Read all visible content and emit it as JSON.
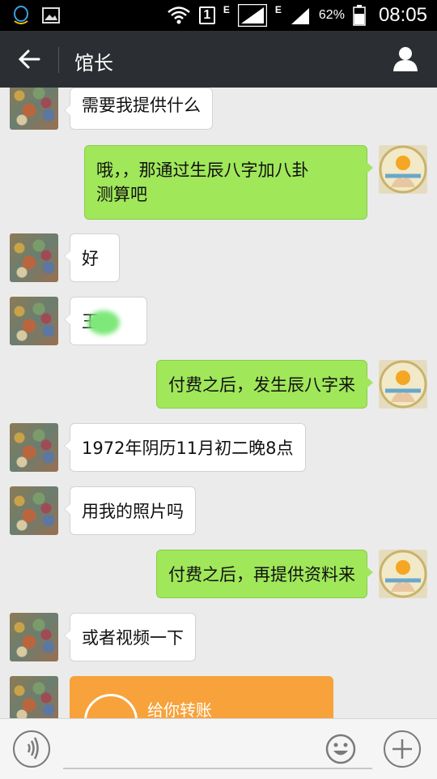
{
  "status_bar": {
    "battery": "62%",
    "time": "08:05",
    "sim": "1",
    "network_label": "E",
    "network_label2": "E",
    "icons": [
      "qq-icon",
      "image-icon",
      "wifi-icon",
      "sim-icon",
      "signal-icon",
      "battery-icon"
    ]
  },
  "header": {
    "title": "馆长",
    "back_icon": "back-arrow-icon",
    "profile_icon": "person-icon"
  },
  "messages": [
    {
      "side": "left",
      "text": "需要我提供什么"
    },
    {
      "side": "right",
      "text_line1": "哦，，那通过生辰八字加八卦",
      "text_line2": "测算吧"
    },
    {
      "side": "left",
      "text": "好"
    },
    {
      "side": "left",
      "text": "王"
    },
    {
      "side": "right",
      "text": "付费之后，发生辰八字来"
    },
    {
      "side": "left",
      "text": "1972年阴历11月初二晚8点"
    },
    {
      "side": "left",
      "text": "用我的照片吗"
    },
    {
      "side": "right",
      "text": "付费之后，再提供资料来"
    },
    {
      "side": "left",
      "text": "或者视频一下"
    },
    {
      "side": "left",
      "type": "transfer",
      "text": "给你转账"
    }
  ],
  "input_bar": {
    "placeholder": "",
    "voice_icon": "voice-icon",
    "emoji_icon": "emoji-icon",
    "plus_icon": "plus-icon"
  },
  "colors": {
    "header_bg": "#2b2f33",
    "chat_bg": "#ebebeb",
    "sent_bubble": "#a0e75a",
    "received_bubble": "#ffffff",
    "transfer_bubble": "#f7a23b"
  }
}
